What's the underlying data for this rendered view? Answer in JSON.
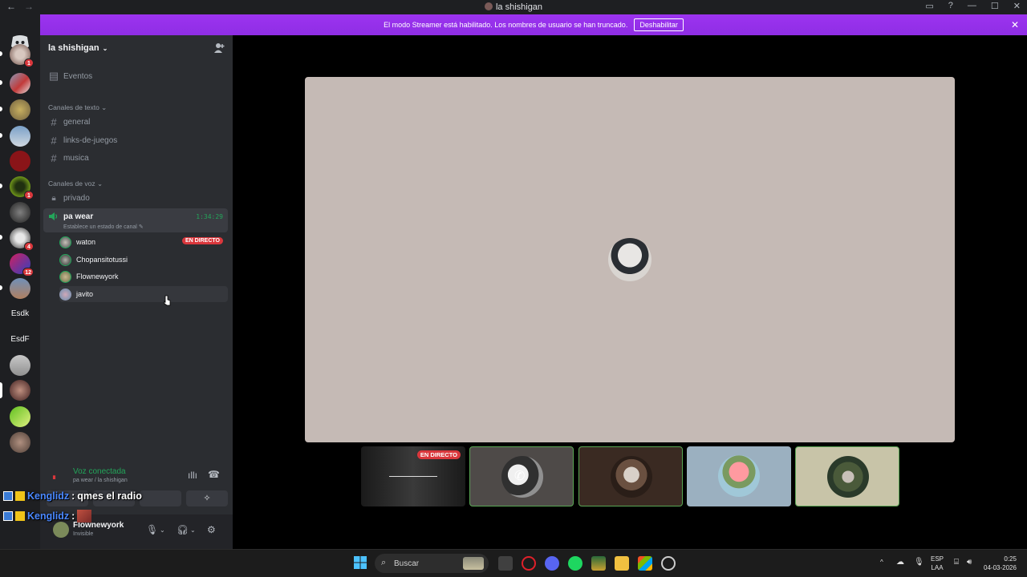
{
  "window": {
    "title": "la shishigan",
    "back": "←",
    "forward": "→",
    "minimize": "—",
    "maximize": "☐",
    "close": "✕"
  },
  "banner": {
    "text": "El modo Streamer está habilitado. Los nombres de usuario se han truncado.",
    "button": "Deshabilitar",
    "close": "✕"
  },
  "guilds": {
    "texts": [
      "Esdk",
      "EsdF"
    ],
    "badges": [
      "1",
      "1",
      "4",
      "12"
    ]
  },
  "server": {
    "name": "la shishigan",
    "events_label": "Eventos",
    "text_category": "Canales de texto",
    "text_channels": [
      "general",
      "links-de-juegos",
      "musica"
    ],
    "voice_category": "Canales de voz",
    "private_channel": "privado",
    "active_voice": {
      "name": "pa wear",
      "status": "Establece un estado de canal",
      "timer": "1:34:29"
    },
    "members": [
      {
        "name": "waton",
        "live": "EN DIRECTO"
      },
      {
        "name": "Chopansitotussi"
      },
      {
        "name": "Flownewyork"
      },
      {
        "name": "javito"
      }
    ]
  },
  "voice_connection": {
    "title": "Voz conectada",
    "subtitle": "pa wear / la shishigan"
  },
  "user": {
    "name": "Flownewyork",
    "status": "Invisible"
  },
  "overlay_chat": [
    {
      "user": "Kenglidz",
      "sep": ":",
      "text": "qmes el radio"
    },
    {
      "user": "Kenglidz",
      "sep": ":",
      "text": ""
    }
  ],
  "stage": {
    "thumb_live": "EN DIRECTO"
  },
  "taskbar": {
    "search": "Buscar",
    "lang": "ESP",
    "lang2": "LAA",
    "time": "0:25",
    "date": "04-03-2026"
  },
  "colors": {
    "accent": "#9c33f0",
    "online": "#23a55a",
    "live": "#da373c",
    "stage": "#c5bab5"
  }
}
